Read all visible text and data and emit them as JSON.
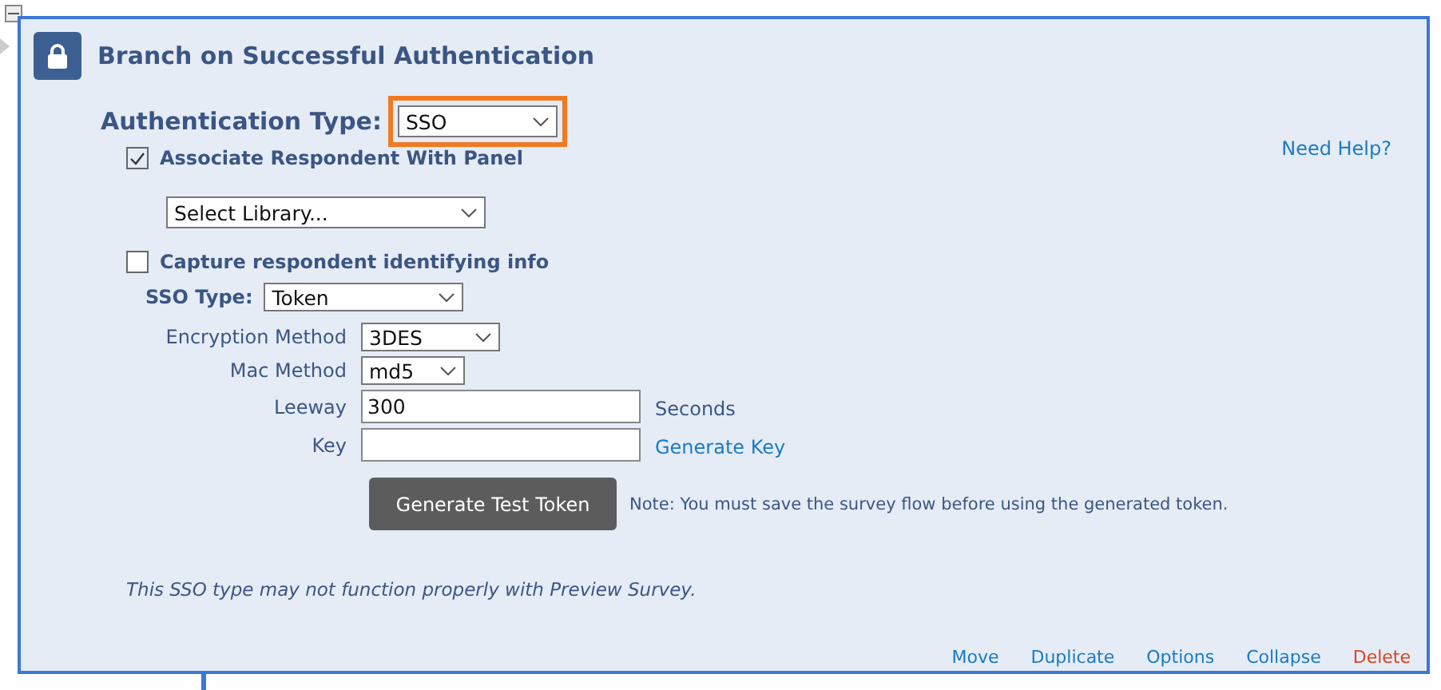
{
  "block": {
    "title": "Branch on Successful Authentication",
    "expanded": true
  },
  "authentication_type": {
    "label": "Authentication Type:",
    "value": "SSO",
    "highlighted": true
  },
  "associate_panel": {
    "label": "Associate Respondent With Panel",
    "checked": true
  },
  "help_link": "Need Help?",
  "library_select": {
    "value": "Select Library..."
  },
  "capture_info": {
    "label": "Capture respondent identifying info",
    "checked": false
  },
  "sso_type": {
    "label": "SSO Type:",
    "value": "Token"
  },
  "fields": [
    {
      "kind": "select",
      "label": "Encryption Method",
      "value": "3DES"
    },
    {
      "kind": "select",
      "label": "Mac Method",
      "value": "md5"
    },
    {
      "kind": "input",
      "label": "Leeway",
      "value": "300",
      "suffix": "Seconds"
    },
    {
      "kind": "input",
      "label": "Key",
      "link": "Generate Key"
    }
  ],
  "generate_button": "Generate Test Token",
  "note": "Note: You must save the survey flow before using the generated token.",
  "preview_warning": "This SSO type may not function properly with Preview Survey.",
  "actions": [
    {
      "label": "Move",
      "kind": "normal"
    },
    {
      "label": "Duplicate",
      "kind": "normal"
    },
    {
      "label": "Options",
      "kind": "normal"
    },
    {
      "label": "Collapse",
      "kind": "normal"
    },
    {
      "label": "Delete",
      "kind": "danger"
    }
  ]
}
